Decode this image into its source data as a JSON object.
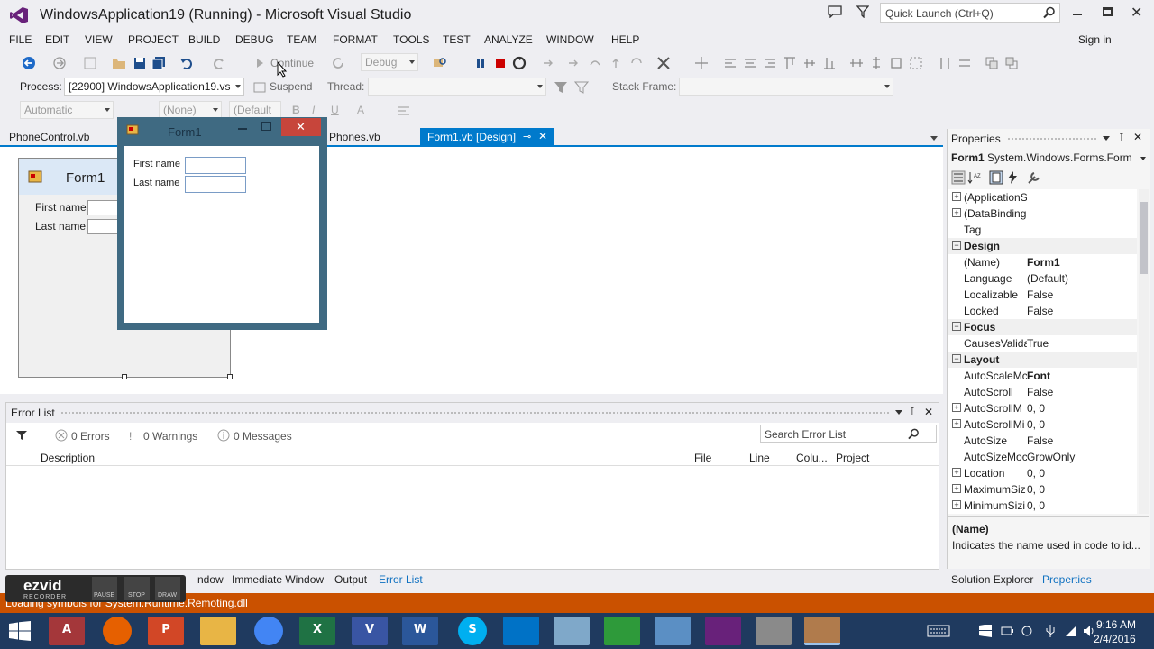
{
  "window": {
    "title": "WindowsApplication19 (Running) - Microsoft Visual Studio",
    "quick_launch_placeholder": "Quick Launch (Ctrl+Q)",
    "sign_in": "Sign in"
  },
  "menu": [
    "FILE",
    "EDIT",
    "VIEW",
    "PROJECT",
    "BUILD",
    "DEBUG",
    "TEAM",
    "FORMAT",
    "TOOLS",
    "TEST",
    "ANALYZE",
    "WINDOW",
    "HELP"
  ],
  "toolbar": {
    "continue_label": "Continue",
    "config": "Debug",
    "process_label": "Process:",
    "process_value": "[22900] WindowsApplication19.vs",
    "suspend_label": "Suspend",
    "thread_label": "Thread:",
    "stack_frame_label": "Stack Frame:",
    "font_mode": "Automatic",
    "font_none": "(None)",
    "font_default": "(Default"
  },
  "doc_tabs": {
    "tab1": "PhoneControl.vb",
    "tab2": "Phones.vb",
    "tab3": "Form1.vb [Design]"
  },
  "design_form": {
    "title": "Form1",
    "first_name_label": "First name",
    "last_name_label": "Last name"
  },
  "running_form": {
    "title": "Form1",
    "first_name_label": "First name",
    "last_name_label": "Last name"
  },
  "error_list": {
    "title": "Error List",
    "errors": "0 Errors",
    "warnings": "0 Warnings",
    "messages": "0 Messages",
    "search_placeholder": "Search Error List",
    "columns": {
      "description": "Description",
      "file": "File",
      "line": "Line",
      "column": "Colu...",
      "project": "Project"
    }
  },
  "properties": {
    "title": "Properties",
    "object_name": "Form1",
    "object_type": "System.Windows.Forms.Form",
    "rows": [
      {
        "kind": "collapsed",
        "name": "(ApplicationS",
        "value": ""
      },
      {
        "kind": "collapsed",
        "name": "(DataBinding",
        "value": ""
      },
      {
        "kind": "plain",
        "name": "Tag",
        "value": ""
      },
      {
        "kind": "category",
        "name": "Design",
        "value": ""
      },
      {
        "kind": "plain",
        "name": "(Name)",
        "value": "Form1",
        "bold": true
      },
      {
        "kind": "plain",
        "name": "Language",
        "value": "(Default)"
      },
      {
        "kind": "plain",
        "name": "Localizable",
        "value": "False"
      },
      {
        "kind": "plain",
        "name": "Locked",
        "value": "False"
      },
      {
        "kind": "category",
        "name": "Focus",
        "value": ""
      },
      {
        "kind": "plain",
        "name": "CausesValida",
        "value": "True"
      },
      {
        "kind": "category",
        "name": "Layout",
        "value": ""
      },
      {
        "kind": "plain",
        "name": "AutoScaleMc",
        "value": "Font",
        "bold": true
      },
      {
        "kind": "plain",
        "name": "AutoScroll",
        "value": "False"
      },
      {
        "kind": "collapsed",
        "name": "AutoScrollM",
        "value": "0, 0"
      },
      {
        "kind": "collapsed",
        "name": "AutoScrollMi",
        "value": "0, 0"
      },
      {
        "kind": "plain",
        "name": "AutoSize",
        "value": "False"
      },
      {
        "kind": "plain",
        "name": "AutoSizeMoc",
        "value": "GrowOnly"
      },
      {
        "kind": "collapsed",
        "name": "Location",
        "value": "0, 0"
      },
      {
        "kind": "collapsed",
        "name": "MaximumSiz",
        "value": "0, 0"
      },
      {
        "kind": "collapsed",
        "name": "MinimumSizi",
        "value": "0, 0"
      }
    ],
    "desc_title": "(Name)",
    "desc_text": "Indicates the name used in code to id..."
  },
  "bottom_tabs": {
    "window": "ndow",
    "immediate": "Immediate Window",
    "output": "Output",
    "error_list": "Error List",
    "solution_explorer": "Solution Explorer",
    "properties": "Properties"
  },
  "status": {
    "text": "Loading symbols for System.Runtime.Remoting.dll"
  },
  "ezvid": {
    "brand": "ezvid",
    "sub": "RECORDER",
    "pause": "PAUSE",
    "stop": "STOP",
    "draw": "DRAW"
  },
  "taskbar": {
    "time": "9:16 AM",
    "date": "2/4/2016",
    "apps": [
      {
        "name": "access",
        "label": "A",
        "color": "#a4373a"
      },
      {
        "name": "firefox",
        "label": "",
        "color": "#e66000"
      },
      {
        "name": "powerpoint",
        "label": "P",
        "color": "#d24726"
      },
      {
        "name": "explorer",
        "label": "",
        "color": "#e8b545"
      },
      {
        "name": "chrome",
        "label": "",
        "color": "#4285f4"
      },
      {
        "name": "excel",
        "label": "X",
        "color": "#1f7244"
      },
      {
        "name": "visio",
        "label": "V",
        "color": "#3955a3"
      },
      {
        "name": "word",
        "label": "W",
        "color": "#2b579a"
      },
      {
        "name": "skype",
        "label": "S",
        "color": "#00aff0"
      },
      {
        "name": "mail",
        "label": "",
        "color": "#0072c6"
      },
      {
        "name": "notes",
        "label": "",
        "color": "#7fa8c9"
      },
      {
        "name": "calculator",
        "label": "",
        "color": "#2e9a3a"
      },
      {
        "name": "photos",
        "label": "",
        "color": "#5b8fc4"
      },
      {
        "name": "visual-studio",
        "label": "",
        "color": "#68217a"
      },
      {
        "name": "tools",
        "label": "",
        "color": "#8a8a8a"
      },
      {
        "name": "running-form",
        "label": "",
        "color": "#b07b4c"
      }
    ]
  }
}
